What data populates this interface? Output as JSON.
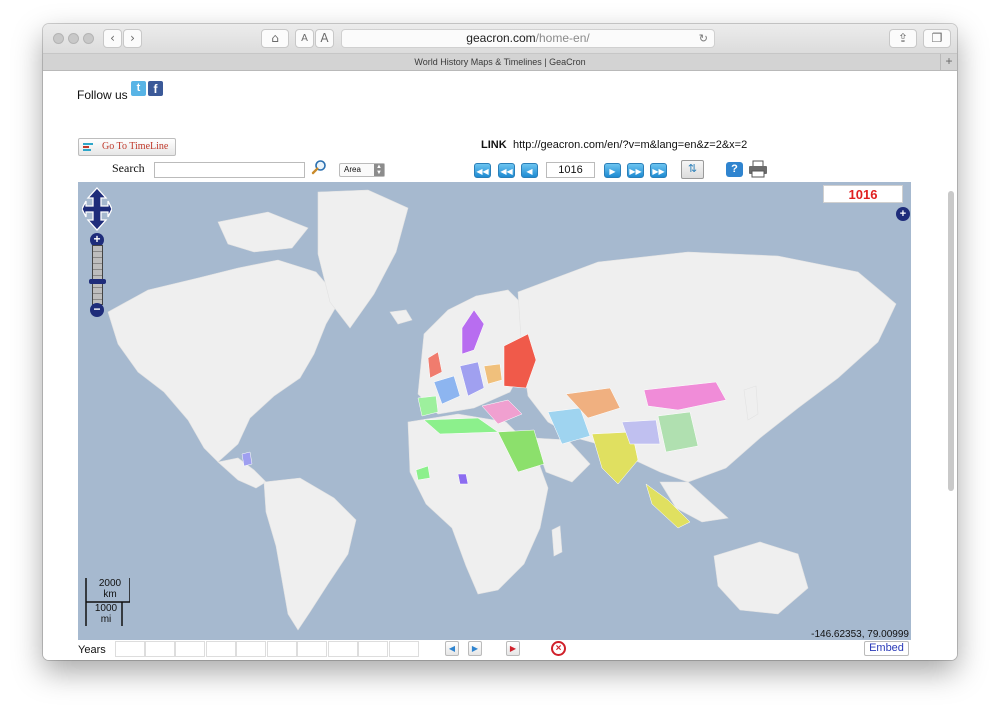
{
  "browser": {
    "url_domain": "geacron.com",
    "url_path": "/home-en/",
    "tab_title": "World History Maps & Timelines | GeaCron",
    "reader_small": "A",
    "reader_large": "A"
  },
  "header": {
    "follow_label": "Follow us",
    "twitter_glyph": "t",
    "facebook_glyph": "f",
    "goto_timeline_label": "Go To TimeLine",
    "link_label": "LINK",
    "link_value": "http://geacron.com/en/?v=m&lang=en&z=2&x=2"
  },
  "search": {
    "label": "Search",
    "value": "",
    "area_option": "Area"
  },
  "timeline_nav": {
    "year_value": "1016"
  },
  "map": {
    "year_display": "1016",
    "scale_km": "2000\nkm",
    "scale_mi": "1000\nmi",
    "coordinates": "-146.62353, 79.00999",
    "colors": {
      "ocean": "#a6b9cf",
      "land": "#f0f0f0",
      "accent": "#2f84cf"
    }
  },
  "footer": {
    "years_label": "Years",
    "embed_label": "Embed"
  }
}
